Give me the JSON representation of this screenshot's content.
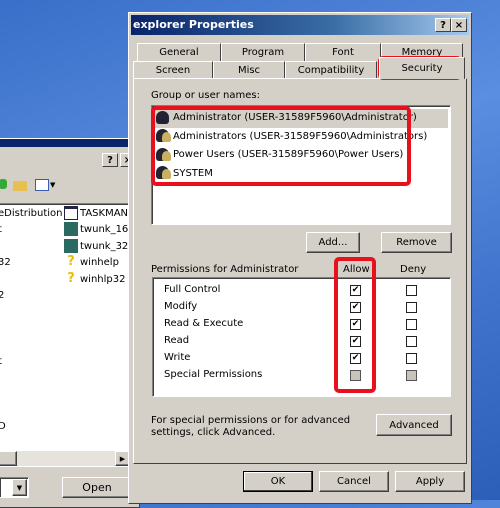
{
  "left_window": {
    "help_label": "?",
    "close_label": "×",
    "files_col1": [
      "eDistribution",
      "t",
      "",
      "32",
      "",
      "2",
      "",
      "",
      "",
      "t",
      "",
      "",
      "",
      "D"
    ],
    "files_col2": [
      {
        "name": "TASKMAN",
        "icon": "window-icon"
      },
      {
        "name": "twunk_16",
        "icon": "scanner-icon"
      },
      {
        "name": "twunk_32",
        "icon": "scanner-icon"
      },
      {
        "name": "winhelp",
        "icon": "help-icon"
      },
      {
        "name": "winhlp32",
        "icon": "help-icon"
      }
    ],
    "open_label": "Open"
  },
  "dialog": {
    "title": "explorer Properties",
    "help_label": "?",
    "close_label": "×",
    "tabs_row1": [
      "General",
      "Program",
      "Font",
      "Memory"
    ],
    "tabs_row2": [
      "Screen",
      "Misc",
      "Compatibility",
      "Security"
    ],
    "active_tab": "Security",
    "group_label": "Group or user names:",
    "users": [
      {
        "name": "Administrator (USER-31589F5960\\Administrator)",
        "selected": true
      },
      {
        "name": "Administrators (USER-31589F5960\\Administrators)",
        "selected": false
      },
      {
        "name": "Power Users (USER-31589F5960\\Power Users)",
        "selected": false
      },
      {
        "name": "SYSTEM",
        "selected": false
      }
    ],
    "add_label": "Add...",
    "remove_label": "Remove",
    "permissions_label": "Permissions for Administrator",
    "allow_label": "Allow",
    "deny_label": "Deny",
    "permissions": [
      {
        "name": "Full Control",
        "allow": true,
        "deny": false
      },
      {
        "name": "Modify",
        "allow": true,
        "deny": false
      },
      {
        "name": "Read & Execute",
        "allow": true,
        "deny": false
      },
      {
        "name": "Read",
        "allow": true,
        "deny": false
      },
      {
        "name": "Write",
        "allow": true,
        "deny": false
      },
      {
        "name": "Special Permissions",
        "allow": false,
        "deny": false,
        "disabled": true
      }
    ],
    "advanced_text": "For special permissions or for advanced settings, click Advanced.",
    "advanced_label": "Advanced",
    "ok_label": "OK",
    "cancel_label": "Cancel",
    "apply_label": "Apply",
    "highlight_color": "#e8101c"
  }
}
